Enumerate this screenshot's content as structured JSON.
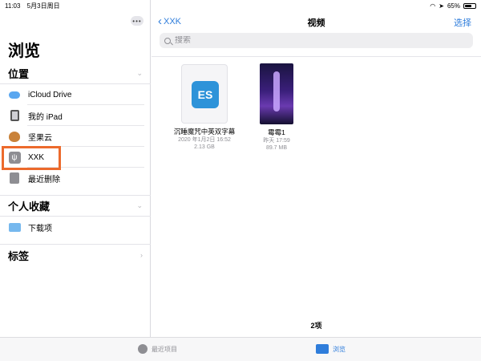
{
  "status_bar": {
    "time": "11:03",
    "date": "5月3日周日",
    "battery": "65%"
  },
  "sidebar": {
    "title": "浏览",
    "more_glyph": "•••",
    "locations": {
      "header": "位置",
      "items": [
        {
          "label": "iCloud Drive",
          "icon": "cloud-icon"
        },
        {
          "label": "我的 iPad",
          "icon": "ipad-icon"
        },
        {
          "label": "坚果云",
          "icon": "nut-icon"
        },
        {
          "label": "XXK",
          "icon": "usb-icon",
          "highlighted": true
        },
        {
          "label": "最近删除",
          "icon": "trash-icon"
        }
      ]
    },
    "favorites": {
      "header": "个人收藏",
      "items": [
        {
          "label": "下载项",
          "icon": "folder-icon"
        }
      ]
    },
    "tags": {
      "header": "标签"
    }
  },
  "main": {
    "back_label": "XXK",
    "title": "视频",
    "select_label": "选择",
    "search_placeholder": "搜索",
    "files": [
      {
        "name": "沉睡魔咒中英双字幕",
        "date": "2020 年1月2日 16:52",
        "size": "2.13 GB",
        "icon": "es-file-icon"
      },
      {
        "name": "霉霉1",
        "date": "昨天 17:59",
        "size": "89.7 MB",
        "icon": "video-thumbnail"
      }
    ],
    "count_label": "2项"
  },
  "tabbar": {
    "recent_label": "最近项目",
    "browse_label": "浏览"
  },
  "colors": {
    "accent": "#2f7ddb",
    "highlight": "#ec6a2c"
  }
}
